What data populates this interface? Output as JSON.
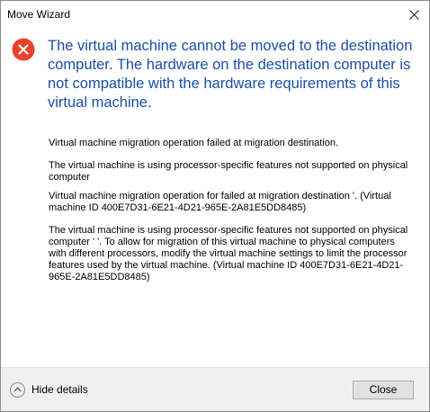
{
  "window": {
    "title": "Move Wizard"
  },
  "error": {
    "main_message": "The virtual machine cannot be moved to the destination computer. The hardware on the destination computer is not compatible with the hardware requirements of this virtual machine."
  },
  "details": {
    "lines": [
      "Virtual machine migration operation failed at migration destination.",
      "The virtual machine is using processor-specific features not supported on physical computer",
      "Virtual machine migration operation for            failed at migration destination                          '. (Virtual machine ID 400E7D31-6E21-4D21-965E-2A81E5DD8485)",
      "The virtual machine            is using processor-specific features not supported on physical computer '                          '. To allow for migration of this virtual machine to physical computers with different processors, modify the virtual machine settings to limit the processor features used by the virtual machine. (Virtual machine ID 400E7D31-6E21-4D21-965E-2A81E5DD8485)"
    ]
  },
  "footer": {
    "toggle_label": "Hide details",
    "close_label": "Close"
  },
  "colors": {
    "accent_text": "#1b4fa5",
    "error_icon": "#e8412c"
  }
}
